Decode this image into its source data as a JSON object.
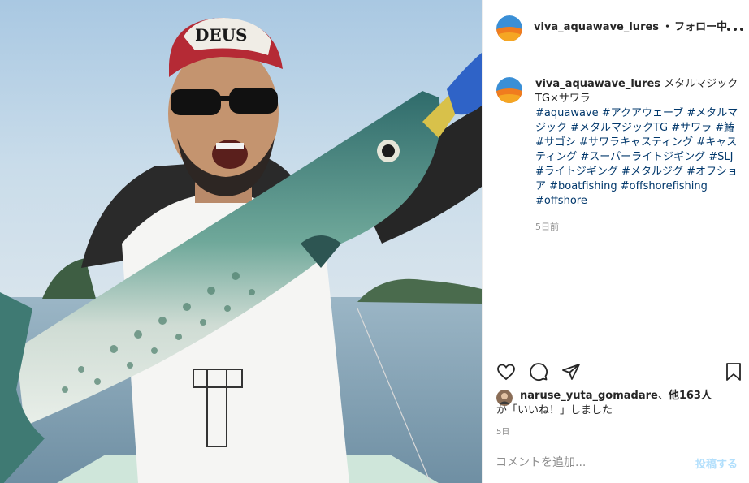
{
  "post": {
    "photo_label": "DEUS",
    "author": "viva_aquawave_lures",
    "follow_separator": "・",
    "follow_state": "フォロー中",
    "caption_text": "メタルマジックTG×サワラ",
    "hashtags": [
      "#aquawave",
      "#アクアウェーブ",
      "#メタルマジック",
      "#メタルマジックTG",
      "#サワラ",
      "#鰆",
      "#サゴシ",
      "#サワラキャスティング",
      "#キャスティング",
      "#スーパーライトジギング",
      "#SLJ",
      "#ライトジギング",
      "#メタルジグ",
      "#オフショア",
      "#boatfishing",
      "#offshorefishing",
      "#offshore"
    ],
    "caption_time": "5日前"
  },
  "actions": {
    "like_icon": "heart-icon",
    "comment_icon": "comment-icon",
    "share_icon": "send-icon",
    "save_icon": "bookmark-icon"
  },
  "likes": {
    "user": "naruse_yuta_gomadare",
    "separator": "、",
    "others": "他163人",
    "suffix": "が「いいね！」しました",
    "time": "5日"
  },
  "comment": {
    "placeholder": "コメントを追加...",
    "post_label": "投稿する"
  },
  "colors": {
    "link": "#00376b",
    "muted": "#8e8e8e",
    "border": "#efefef",
    "post_disabled": "#b2dffc"
  }
}
